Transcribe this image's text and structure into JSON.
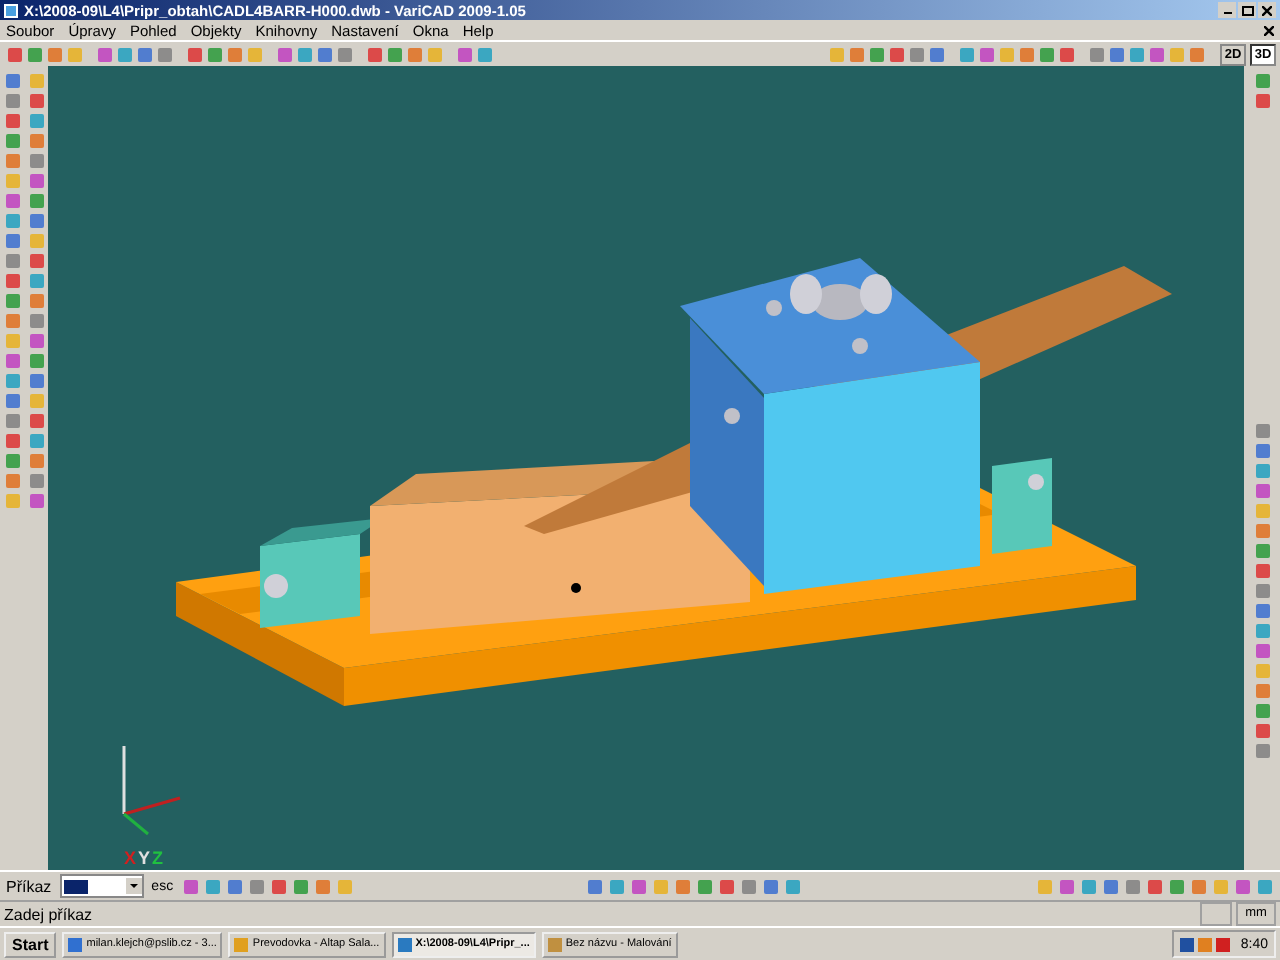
{
  "window": {
    "title": "X:\\2008-09\\L4\\Pripr_obtah\\CADL4BARR-H000.dwb - VariCAD 2009-1.05"
  },
  "menu": [
    "Soubor",
    "Úpravy",
    "Pohled",
    "Objekty",
    "Knihovny",
    "Nastavení",
    "Okna",
    "Help"
  ],
  "view_buttons": [
    {
      "label": "2D",
      "selected": false
    },
    {
      "label": "3D",
      "selected": true
    }
  ],
  "axes": [
    "X",
    "Y",
    "Z"
  ],
  "command_bar": {
    "label": "Příkaz",
    "esc": "esc"
  },
  "status_bar": {
    "prompt": "Zadej příkaz",
    "units": "mm"
  },
  "taskbar": {
    "start": "Start",
    "items": [
      {
        "label": "milan.klejch@pslib.cz - 3...",
        "selected": false
      },
      {
        "label": "Prevodovka - Altap Sala...",
        "selected": false
      },
      {
        "label": "X:\\2008-09\\L4\\Pripr_...",
        "selected": true
      },
      {
        "label": "Bez názvu - Malování",
        "selected": false
      }
    ],
    "clock": "8:40"
  }
}
